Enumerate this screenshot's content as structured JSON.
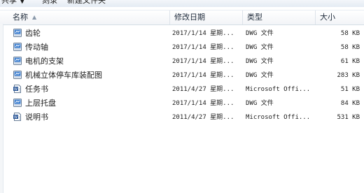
{
  "toolbar": {
    "share": "共享 ▼",
    "burn": "刻录",
    "new_folder": "新建文件夹"
  },
  "columns": {
    "name": "名称",
    "date": "修改日期",
    "type": "类型",
    "size": "大小"
  },
  "files": [
    {
      "name": "齿轮",
      "date": "2017/1/14 星期...",
      "type": "DWG 文件",
      "size": "58 KB",
      "icon": "dwg-file-icon"
    },
    {
      "name": "传动轴",
      "date": "2017/1/14 星期...",
      "type": "DWG 文件",
      "size": "58 KB",
      "icon": "dwg-file-icon"
    },
    {
      "name": "电机的支架",
      "date": "2017/1/14 星期...",
      "type": "DWG 文件",
      "size": "61 KB",
      "icon": "dwg-file-icon"
    },
    {
      "name": "机械立体停车库装配图",
      "date": "2017/1/14 星期...",
      "type": "DWG 文件",
      "size": "283 KB",
      "icon": "dwg-file-icon"
    },
    {
      "name": "任务书",
      "date": "2011/4/27 星期...",
      "type": "Microsoft Offi...",
      "size": "51 KB",
      "icon": "word-doc-icon"
    },
    {
      "name": "上层托盘",
      "date": "2017/1/14 星期...",
      "type": "DWG 文件",
      "size": "84 KB",
      "icon": "dwg-file-icon"
    },
    {
      "name": "说明书",
      "date": "2011/4/27 星期...",
      "type": "Microsoft Offi...",
      "size": "531 KB",
      "icon": "word-doc-icon"
    }
  ]
}
